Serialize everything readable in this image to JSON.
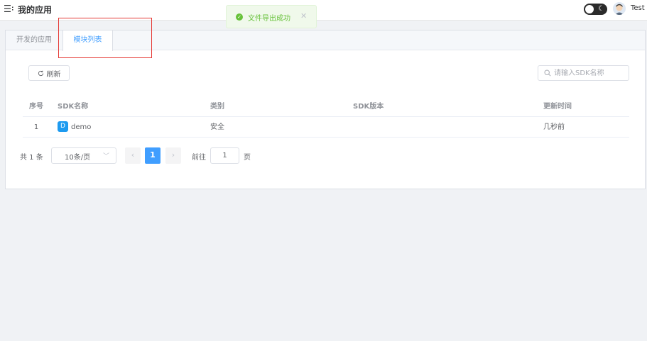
{
  "header": {
    "title": "我的应用",
    "username": "Test"
  },
  "toast": {
    "message": "文件导出成功",
    "close": "✕",
    "icon": "success-check-icon"
  },
  "tabs": [
    {
      "label": "开发的应用"
    },
    {
      "label": "模块列表"
    }
  ],
  "toolbar": {
    "refresh_label": "刷新",
    "search_placeholder": "请输入SDK名称"
  },
  "table": {
    "headers": {
      "index": "序号",
      "name": "SDK名称",
      "category": "类别",
      "version": "SDK版本",
      "updated": "更新时间"
    },
    "rows": [
      {
        "index": "1",
        "badge": "D",
        "name": "demo",
        "category": "安全",
        "version": "",
        "updated": "几秒前"
      }
    ]
  },
  "pagination": {
    "total": "共 1 条",
    "page_size": "10条/页",
    "prev": "‹",
    "current_page": "1",
    "next": "›",
    "goto_label": "前往",
    "goto_value": "1",
    "page_unit": "页"
  },
  "colors": {
    "primary": "#409eff",
    "success": "#67c23a",
    "highlight": "#e53935",
    "badge": "#1e9bf0"
  }
}
